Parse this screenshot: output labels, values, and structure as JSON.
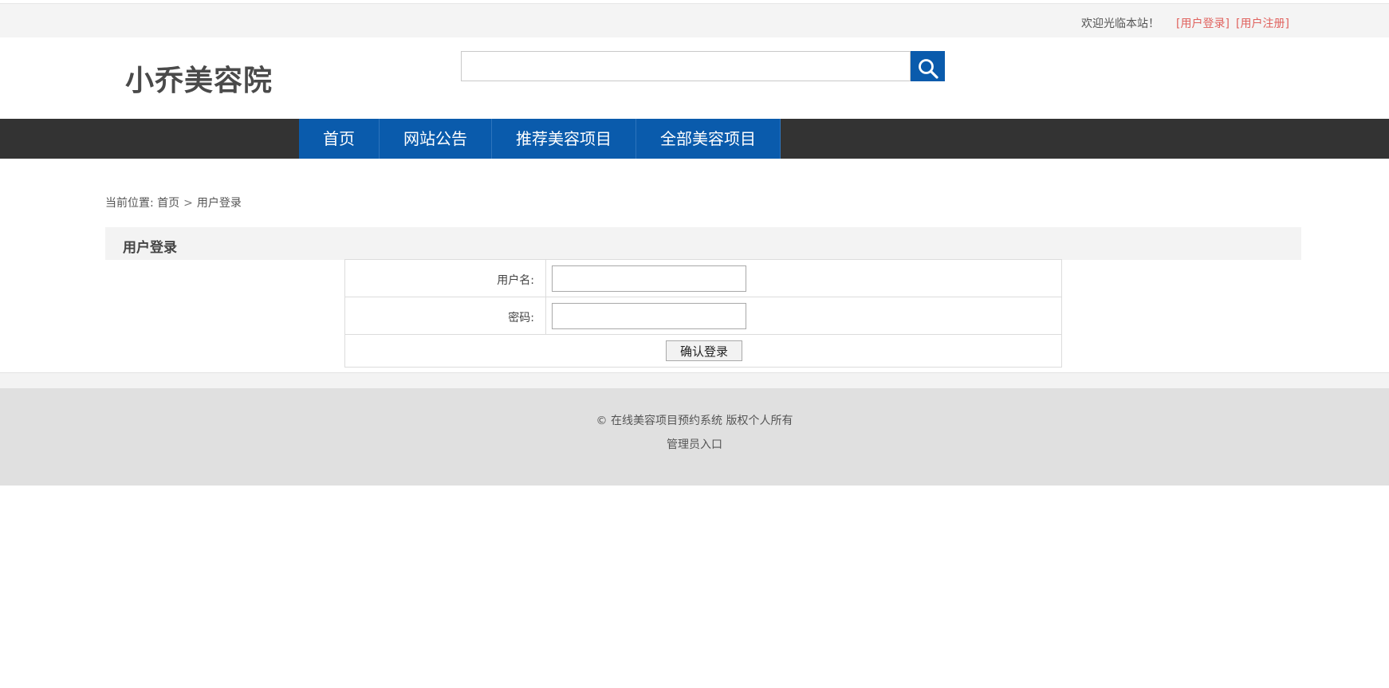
{
  "topbar": {
    "welcome": "欢迎光临本站！",
    "login_link": "[用户登录]",
    "register_link": "[用户注册]"
  },
  "header": {
    "logo": "小乔美容院",
    "search": {
      "value": "",
      "placeholder": ""
    },
    "search_icon": "search-icon"
  },
  "nav": {
    "items": [
      {
        "label": "首页"
      },
      {
        "label": "网站公告"
      },
      {
        "label": "推荐美容项目"
      },
      {
        "label": "全部美容项目"
      }
    ]
  },
  "breadcrumb": {
    "prefix": "当前位置:",
    "home": "首页",
    "separator": ">",
    "current": "用户登录"
  },
  "panel": {
    "title": "用户登录",
    "username_label": "用户名:",
    "username_value": "",
    "password_label": "密码:",
    "password_value": "",
    "submit_label": "确认登录"
  },
  "footer": {
    "copyright": "© 在线美容项目预约系统 版权个人所有",
    "admin_link": "管理员入口"
  },
  "colors": {
    "nav_blue": "#0a5bac",
    "nav_bar": "#333333",
    "link_red": "#e0625e",
    "footer_bg": "#e0e0e0"
  }
}
